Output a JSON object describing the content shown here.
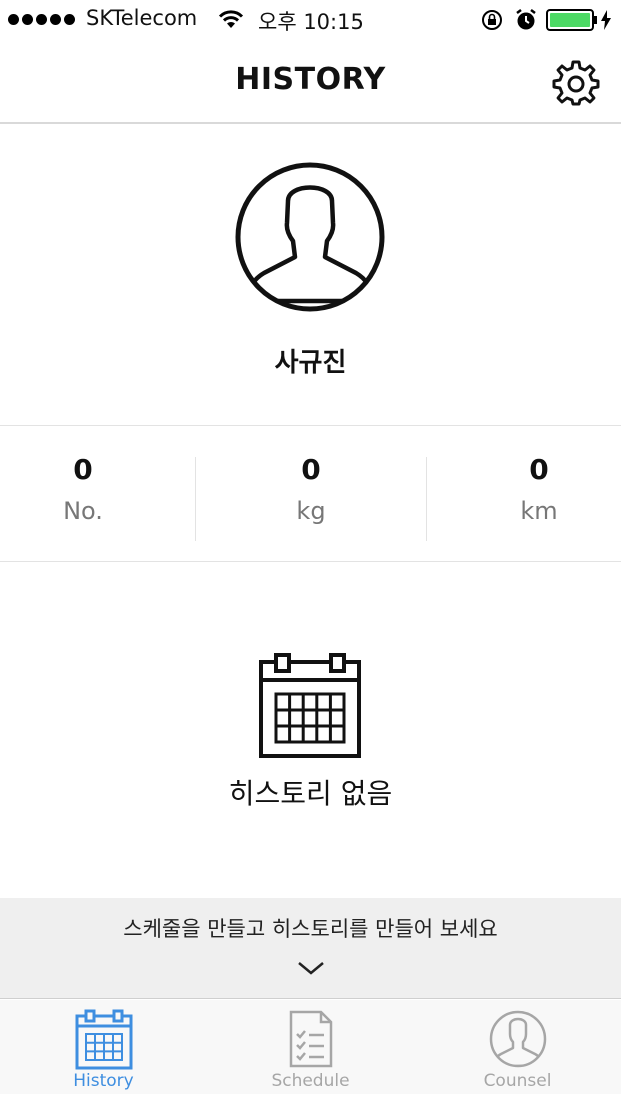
{
  "status_bar": {
    "carrier": "SKTelecom",
    "time": "오후 10:15",
    "signal_bars": 5,
    "battery_color": "#4cd964"
  },
  "nav": {
    "title": "HISTORY",
    "settings_icon": "gear-icon"
  },
  "profile": {
    "name": "사규진",
    "avatar_icon": "user-avatar-icon"
  },
  "stats": [
    {
      "value": "0",
      "unit": "No."
    },
    {
      "value": "0",
      "unit": "kg"
    },
    {
      "value": "0",
      "unit": "km"
    }
  ],
  "empty_state": {
    "icon": "calendar-icon",
    "message": "히스토리 없음"
  },
  "banner": {
    "message": "스케줄을 만들고 히스토리를 만들어 보세요",
    "icon": "chevron-down-icon"
  },
  "tabs": [
    {
      "label": "History",
      "icon": "calendar-icon",
      "active": true
    },
    {
      "label": "Schedule",
      "icon": "checklist-icon",
      "active": false
    },
    {
      "label": "Counsel",
      "icon": "user-avatar-icon",
      "active": false
    }
  ],
  "colors": {
    "accent": "#3e8ee0",
    "inactive": "#a6a6a6",
    "banner_bg": "#efefef"
  }
}
